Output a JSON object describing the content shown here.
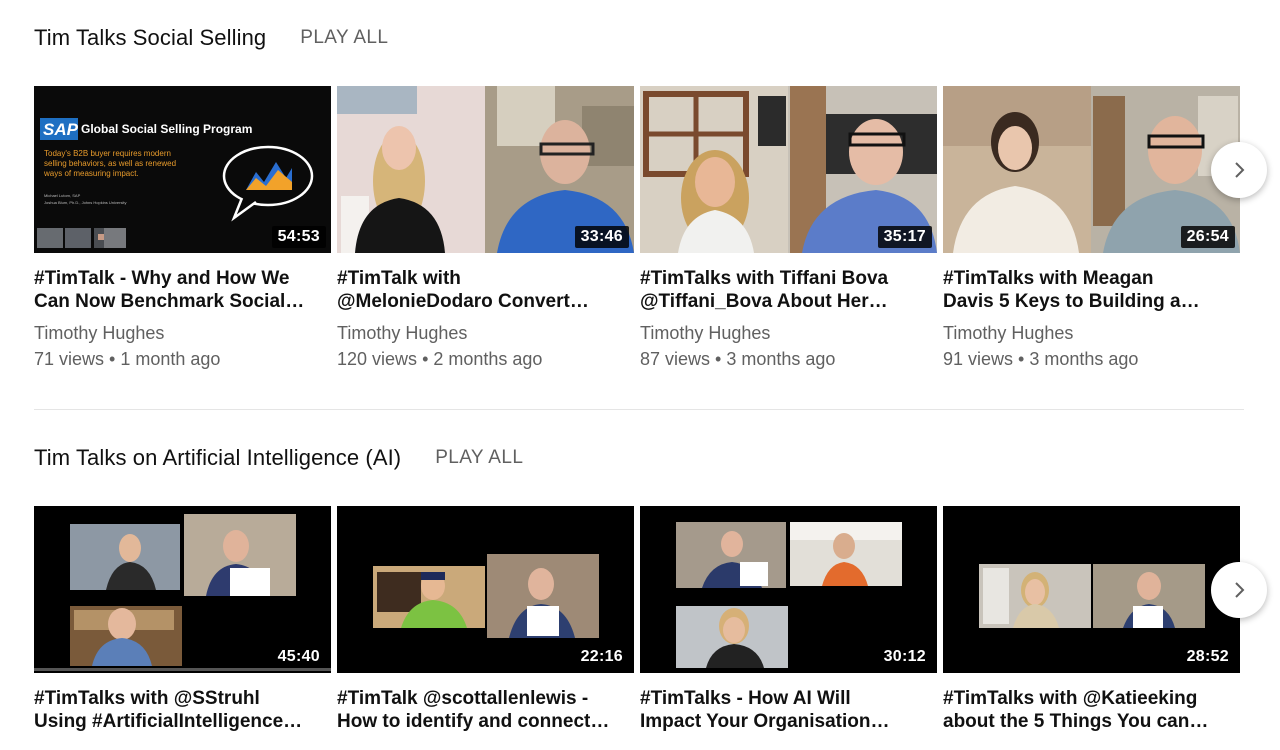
{
  "shelves": [
    {
      "title": "Tim Talks Social Selling",
      "play_all": "PLAY ALL",
      "videos": [
        {
          "title_line1": "#TimTalk - Why and How We",
          "title_line2": "Can Now Benchmark Social…",
          "channel": "Timothy Hughes",
          "views": "71 views",
          "age": "1 month ago",
          "duration": "54:53",
          "slide": {
            "logo": "SAP",
            "heading": "Global Social Selling Program",
            "body1": "Today's B2B buyer requires modern",
            "body2": "selling behaviors, as well as renewed",
            "body3": "ways of measuring impact.",
            "credit1": "Michael Lutom, SAP",
            "credit2": "Joshua Blum, Ph.D., Johns Hopkins University"
          }
        },
        {
          "title_line1": "#TimTalk with",
          "title_line2": "@MelonieDodaro Convert…",
          "channel": "Timothy Hughes",
          "views": "120 views",
          "age": "2 months ago",
          "duration": "33:46"
        },
        {
          "title_line1": "#TimTalks with Tiffani Bova",
          "title_line2": "@Tiffani_Bova About Her…",
          "channel": "Timothy Hughes",
          "views": "87 views",
          "age": "3 months ago",
          "duration": "35:17"
        },
        {
          "title_line1": "#TimTalks with Meagan",
          "title_line2": "Davis 5 Keys to Building a…",
          "channel": "Timothy Hughes",
          "views": "91 views",
          "age": "3 months ago",
          "duration": "26:54"
        }
      ]
    },
    {
      "title": "Tim Talks on Artificial Intelligence (AI)",
      "play_all": "PLAY ALL",
      "videos": [
        {
          "title_line1": "#TimTalks with @SStruhl",
          "title_line2": "Using #ArtificialIntelligence…",
          "duration": "45:40"
        },
        {
          "title_line1": "#TimTalk @scottallenlewis -",
          "title_line2": "How to identify and connect…",
          "duration": "22:16"
        },
        {
          "title_line1": "#TimTalks - How AI Will",
          "title_line2": "Impact Your Organisation…",
          "duration": "30:12"
        },
        {
          "title_line1": "#TimTalks with @Katieeking",
          "title_line2": "about the 5 Things You can…",
          "duration": "28:52"
        }
      ]
    }
  ],
  "icons": {
    "next": "chevron-right-icon"
  },
  "colors": {
    "secondary_text": "#606060",
    "duration_bg": "#000000"
  }
}
